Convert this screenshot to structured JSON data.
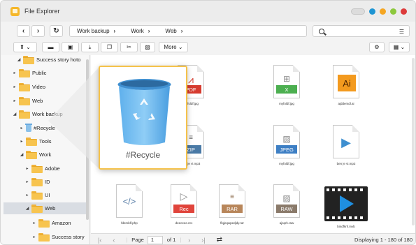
{
  "window": {
    "title": "File Explorer",
    "controls": [
      {
        "name": "toggle",
        "color": "#dcdcdc"
      },
      {
        "name": "blue",
        "color": "#1e95d3"
      },
      {
        "name": "orange",
        "color": "#f5a623"
      },
      {
        "name": "green",
        "color": "#8cc83d"
      },
      {
        "name": "red",
        "color": "#dc3b3b"
      }
    ]
  },
  "nav": {
    "back_icon": "chevron-left-icon",
    "forward_icon": "chevron-right-icon",
    "refresh_icon": "refresh-icon",
    "breadcrumb": [
      "Work backup",
      "Work",
      "Web"
    ],
    "search_placeholder": "",
    "search_icon": "search-icon",
    "view_options_icon": "list-view-icon"
  },
  "toolbar": {
    "upload_icon": "upload-icon",
    "new_folder_icon": "new-folder-icon",
    "new_share_icon": "share-folder-icon",
    "download_icon": "download-icon",
    "copy_icon": "copy-icon",
    "cut_icon": "cut-icon",
    "paste_icon": "paste-icon",
    "more_label": "More",
    "settings_icon": "gear-icon",
    "grid_icon": "grid-view-icon"
  },
  "sidebar": {
    "items": [
      {
        "label": "Success story hoto",
        "expanded": true,
        "kind": "folder"
      },
      {
        "label": "Public",
        "expanded": false,
        "kind": "folder"
      },
      {
        "label": "Video",
        "expanded": false,
        "kind": "folder"
      },
      {
        "label": "Web",
        "expanded": false,
        "kind": "folder"
      },
      {
        "label": "Work backup",
        "expanded": true,
        "kind": "folder"
      },
      {
        "label": "#Recycle",
        "expanded": false,
        "kind": "recycle"
      },
      {
        "label": "Tools",
        "expanded": false,
        "kind": "folder"
      },
      {
        "label": "Work",
        "expanded": true,
        "kind": "folder"
      },
      {
        "label": "Adobe",
        "expanded": false,
        "kind": "folder"
      },
      {
        "label": "ID",
        "expanded": false,
        "kind": "folder"
      },
      {
        "label": "UI",
        "expanded": false,
        "kind": "folder"
      },
      {
        "label": "Web",
        "expanded": true,
        "kind": "folder",
        "selected": true
      },
      {
        "label": "Amazon",
        "expanded": false,
        "kind": "folder"
      },
      {
        "label": "Success story",
        "expanded": false,
        "kind": "folder"
      }
    ]
  },
  "files": [
    {
      "name": "myfoldf.jpg",
      "type": "pdf",
      "label": "PDF",
      "color": "#d63b2f"
    },
    {
      "name": "myfoldf.jpg",
      "type": "xls",
      "label": "X",
      "color": "#4caf50"
    },
    {
      "name": "ajddemdl.ai",
      "type": "ai",
      "label": "Ai",
      "color": "#f39a1e"
    },
    {
      "name": "ben je vi.mp3",
      "type": "zip",
      "label": "ZIP",
      "color": "#4a7aa6"
    },
    {
      "name": "myfoldf.jpg",
      "type": "jpeg",
      "label": "JPEG",
      "color": "#3e7fc4"
    },
    {
      "name": "ben je vi.mp3",
      "type": "mp3",
      "label": "",
      "color": "#3e8fd0"
    },
    {
      "name": "fdemldf.php",
      "type": "code",
      "label": "</>",
      "color": "#5a7fa8"
    },
    {
      "name": "deeceee.rec",
      "type": "rec",
      "label": "Rec",
      "color": "#e0443b"
    },
    {
      "name": "flqjeqwpedjdy.rar",
      "type": "rar",
      "label": "RAR",
      "color": "#b8865a"
    },
    {
      "name": "ajsqrk.raw",
      "type": "raw",
      "label": "RAW",
      "color": "#8a7a6a"
    },
    {
      "name": "bindfknf.mvb",
      "type": "video",
      "label": "",
      "color": "#1f8fe0"
    }
  ],
  "footer": {
    "page_label": "Page",
    "page_value": "1",
    "of_label": "of 1",
    "status": "Displaying 1 - 180 of 180"
  },
  "callout": {
    "label": "#Recycle",
    "icon": "recycle-bin-icon"
  }
}
